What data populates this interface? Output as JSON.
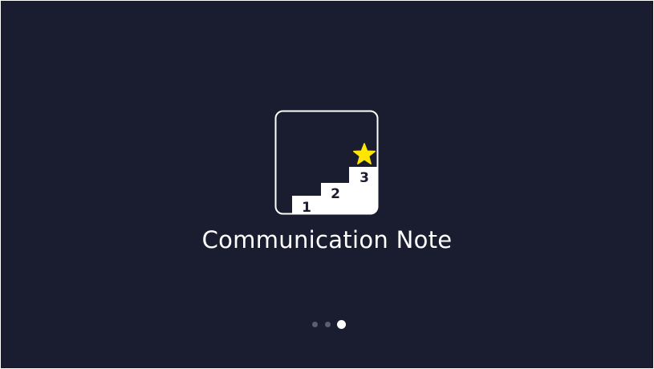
{
  "app": {
    "title": "Communication Note",
    "background_color": "#1a1d2f",
    "accent_color": "#ffe600"
  },
  "logo": {
    "icon": "podium-steps-star-icon",
    "steps": [
      "1",
      "2",
      "3"
    ],
    "star_icon": "star-icon"
  },
  "pagination": {
    "total_pages": 3,
    "current_page": 3
  }
}
